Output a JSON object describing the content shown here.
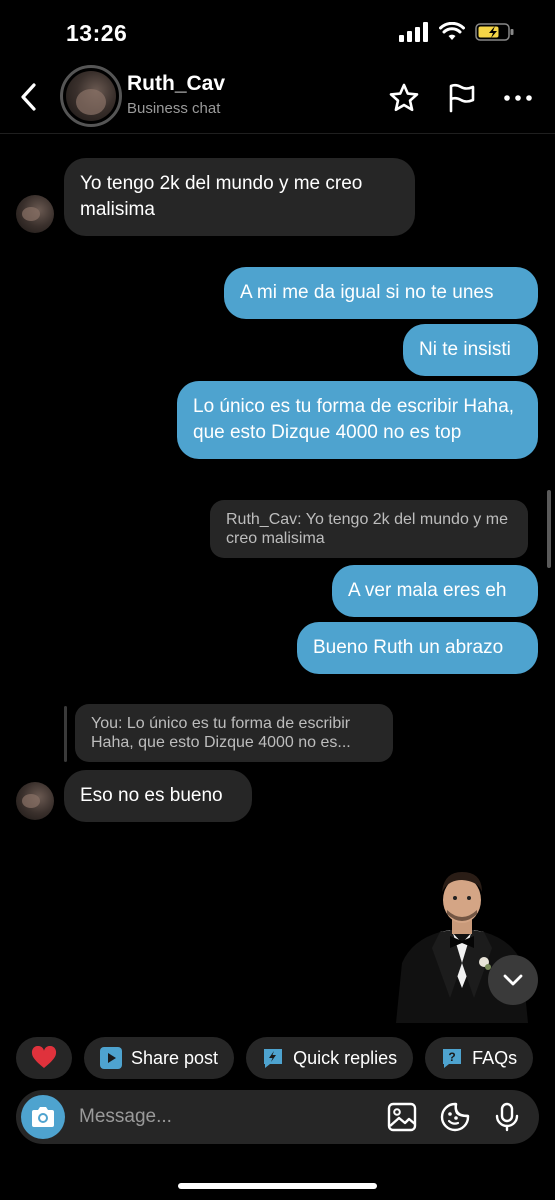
{
  "status_bar": {
    "time": "13:26"
  },
  "header": {
    "contact_name": "Ruth_Cav",
    "subtitle": "Business chat"
  },
  "messages": [
    {
      "dir": "in",
      "text": "Yo tengo 2k del mundo y me creo malisima"
    },
    {
      "dir": "out",
      "text": "A mi me da igual si no te unes"
    },
    {
      "dir": "out",
      "text": "Ni te insisti"
    },
    {
      "dir": "out",
      "text": "Lo único es tu forma de escribir Haha, que esto Dizque 4000 no es top"
    },
    {
      "dir": "quote",
      "text": "Ruth_Cav: Yo tengo 2k del mundo y me creo malisima"
    },
    {
      "dir": "out",
      "text": "A ver mala eres eh"
    },
    {
      "dir": "out",
      "text": "Bueno Ruth un abrazo"
    },
    {
      "dir": "quote",
      "text": "You: Lo único es tu forma de escribir Haha, que esto Dizque 4000 no es..."
    },
    {
      "dir": "in",
      "text": "Eso no es bueno"
    }
  ],
  "quick_actions": {
    "share_post": "Share post",
    "quick_replies": "Quick replies",
    "faqs": "FAQs"
  },
  "composer": {
    "placeholder": "Message..."
  },
  "colors": {
    "background": "#000000",
    "incoming_bubble": "#262626",
    "outgoing_bubble": "#4ea3cf",
    "heart": "#e0323c",
    "battery": "#f5d547"
  },
  "icons": [
    "back-arrow-icon",
    "star-icon",
    "flag-icon",
    "more-icon",
    "heart-icon",
    "play-icon",
    "lightning-icon",
    "question-icon",
    "camera-icon",
    "gallery-icon",
    "sticker-icon",
    "mic-icon",
    "chevron-down-icon"
  ]
}
